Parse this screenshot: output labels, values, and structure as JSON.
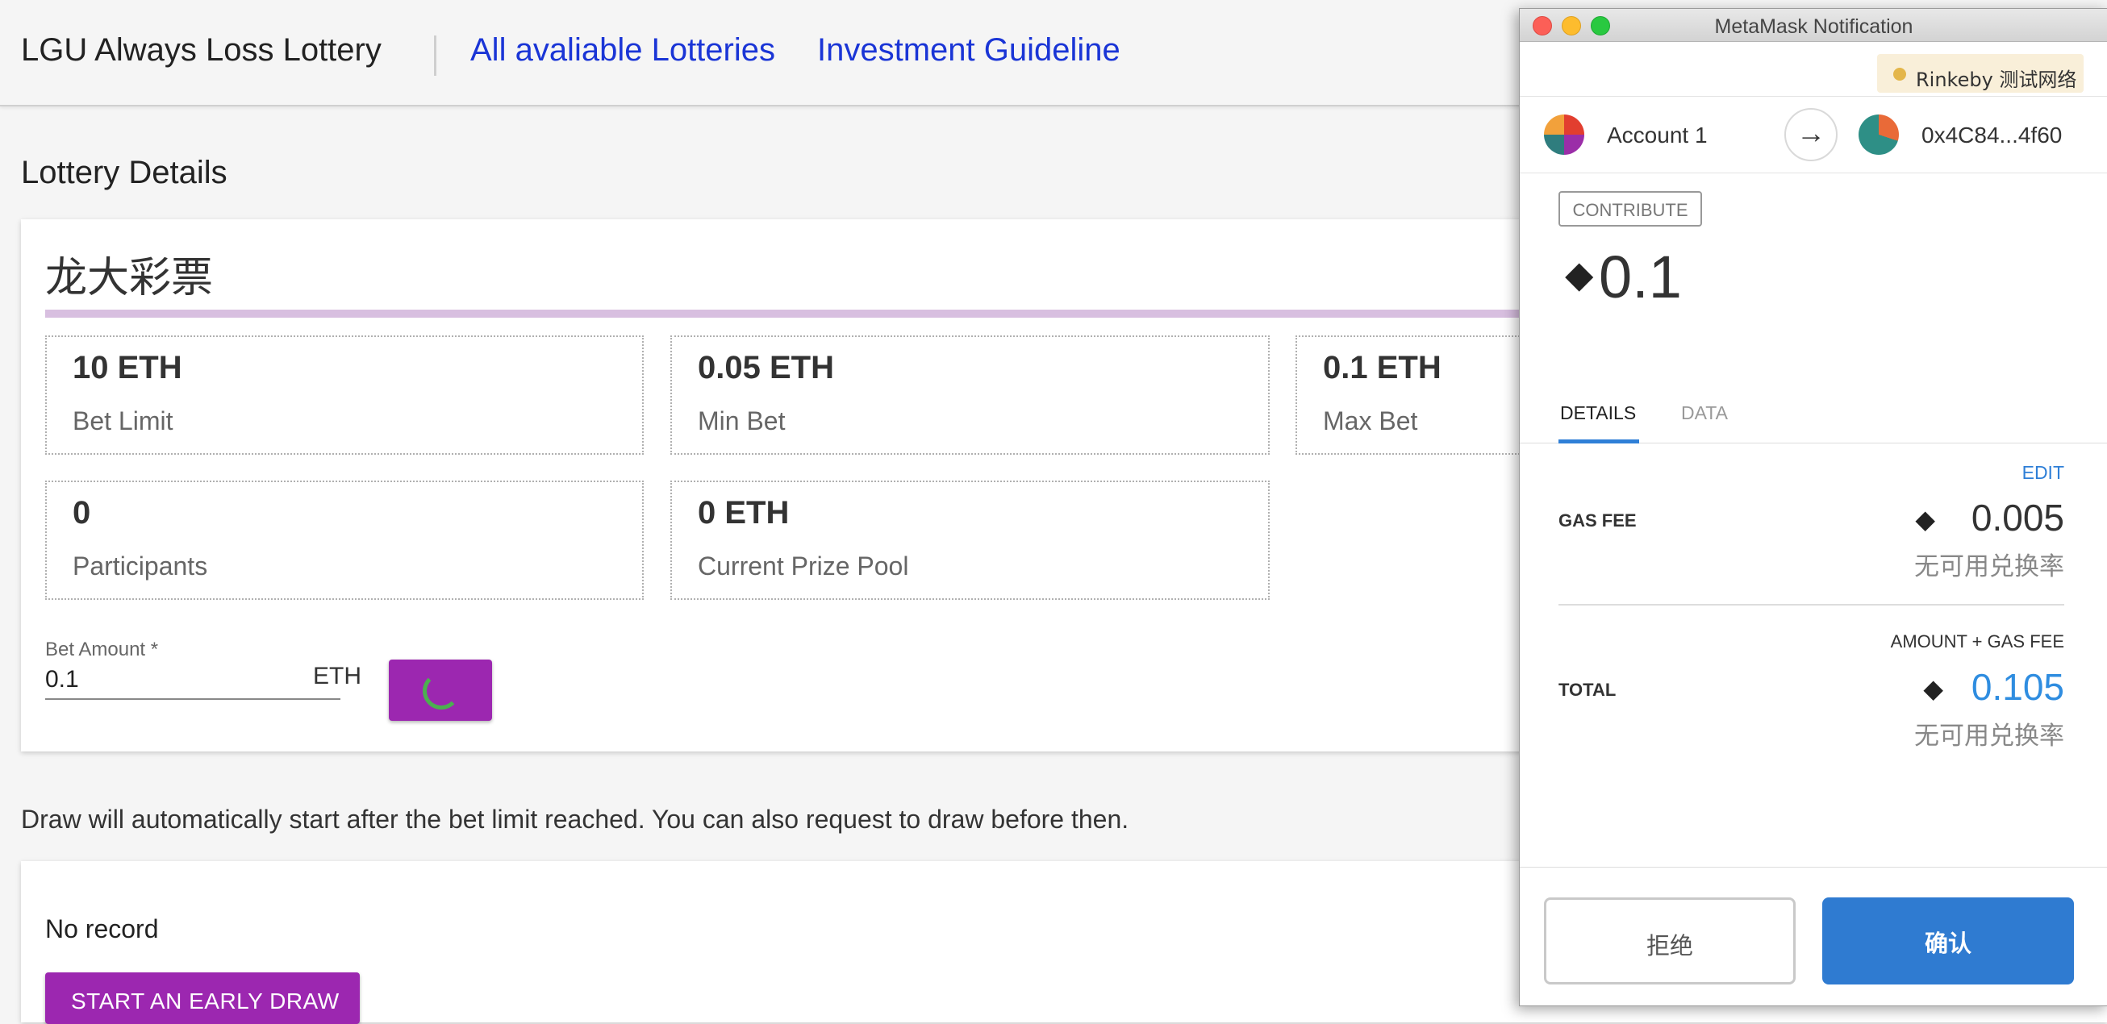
{
  "nav": {
    "brand": "LGU Always Loss Lottery",
    "links": [
      "All avaliable Lotteries",
      "Investment Guideline"
    ]
  },
  "page_title": "Lottery Details",
  "lottery": {
    "name": "龙大彩票",
    "stats": [
      {
        "value": "10 ETH",
        "label": "Bet Limit"
      },
      {
        "value": "0.05 ETH",
        "label": "Min Bet"
      },
      {
        "value": "0.1 ETH",
        "label": "Max Bet"
      },
      {
        "value": "0",
        "label": "Participants"
      },
      {
        "value": "0 ETH",
        "label": "Current Prize Pool"
      }
    ],
    "bet": {
      "label": "Bet Amount *",
      "value": "0.1",
      "unit": "ETH"
    }
  },
  "draw_note": "Draw will automatically start after the bet limit reached. You can also request to draw before then.",
  "records": {
    "empty_text": "No record",
    "early_draw_label": "START AN EARLY DRAW"
  },
  "metamask": {
    "window_title": "MetaMask Notification",
    "network": "Rinkeby 测试网络",
    "from_account": "Account 1",
    "to_address": "0x4C84...4f60",
    "method_badge": "CONTRIBUTE",
    "amount": "0.1",
    "tabs": [
      "DETAILS",
      "DATA"
    ],
    "edit_label": "EDIT",
    "gas_fee_label": "GAS FEE",
    "gas_fee_value": "0.005",
    "gas_fee_fiat": "无可用兑换率",
    "amount_gas_label": "AMOUNT + GAS FEE",
    "total_label": "TOTAL",
    "total_value": "0.105",
    "total_fiat": "无可用兑换率",
    "reject_label": "拒绝",
    "confirm_label": "确认"
  },
  "colors": {
    "nav_link": "#1a35d6",
    "primary_purple": "#9c27b0",
    "metamask_blue": "#2f7bd1",
    "total_blue": "#2f8de0",
    "network_dot": "#e4b64a"
  },
  "icons": {
    "eth": "ethereum-diamond-icon",
    "arrow": "right-arrow-icon",
    "spinner": "loading-spinner-icon"
  }
}
